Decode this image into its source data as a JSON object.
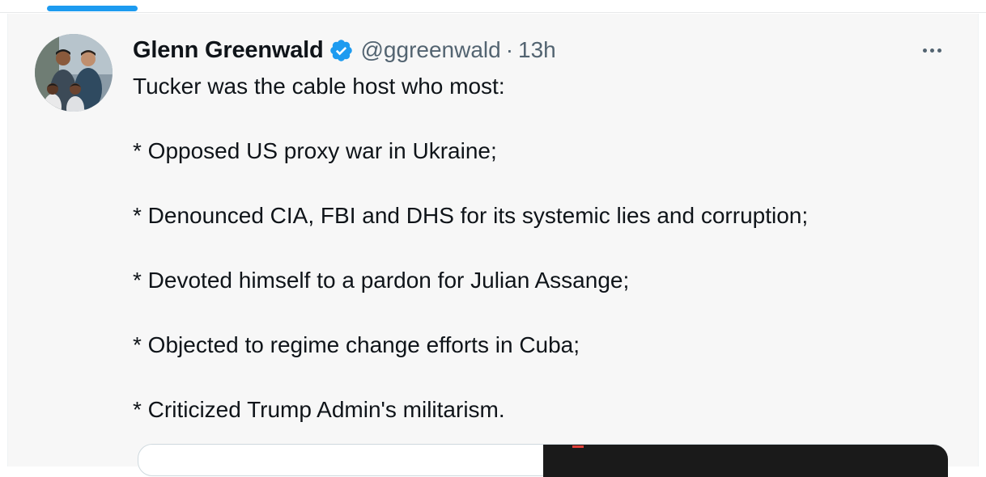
{
  "tweet": {
    "author": {
      "display_name": "Glenn Greenwald",
      "handle": "@ggreenwald",
      "verified": true,
      "avatar": "profile-photo"
    },
    "separator": "·",
    "time": "13h",
    "more_icon": "more-horizontal-icon",
    "text_lines": [
      "Tucker was the cable host who most:",
      "* Opposed US proxy war in Ukraine;",
      "* Denounced CIA, FBI and DHS for its systemic lies and corruption;",
      "* Devoted himself to a pardon for Julian Assange;",
      "* Objected to regime change efforts in Cuba;",
      "* Criticized Trump Admin's militarism."
    ]
  },
  "colors": {
    "accent": "#1d9bf0",
    "text_primary": "#0f1419",
    "text_secondary": "#536471",
    "tweet_background": "#f7f7f7"
  }
}
